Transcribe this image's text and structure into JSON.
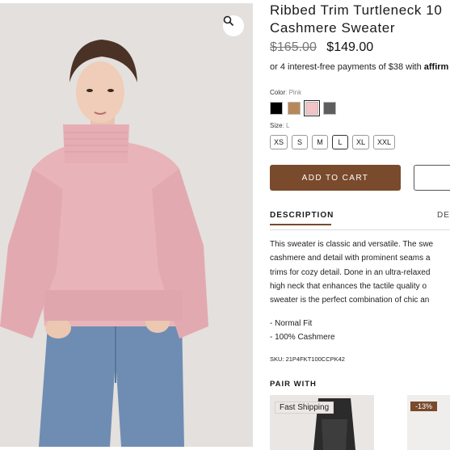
{
  "product": {
    "title_line1": "Ribbed Trim Turtleneck 10",
    "title_line2": "Cashmere Sweater",
    "old_price": "$165.00",
    "price": "$149.00",
    "installments_text": "or 4 interest-free payments of $38 with",
    "installments_provider": "affirm",
    "color_label": "Color",
    "color_value": ": Pink",
    "colors": [
      "#000000",
      "#b8885a",
      "#f2c4c6",
      "#5e5e5e"
    ],
    "selected_color_index": 2,
    "size_label": "Size",
    "size_value": ": L",
    "sizes": [
      "XS",
      "S",
      "M",
      "L",
      "XL",
      "XXL"
    ],
    "selected_size_index": 3,
    "add_to_cart": "ADD TO CART",
    "accent_color": "#7a4a2c"
  },
  "tabs": {
    "description": "DESCRIPTION",
    "details": "DE"
  },
  "description_lines": [
    "This sweater is classic and versatile. The swe",
    "cashmere and detail with prominent seams a",
    "trims for cozy detail. Done in an ultra-relaxed",
    "high neck that enhances the tactile quality o",
    "sweater is the perfect combination of chic an"
  ],
  "features": [
    "- Normal Fit",
    "- 100% Cashmere"
  ],
  "sku": "SKU: 21P4FKT100CCPK42",
  "pair_with": {
    "title": "PAIR WITH",
    "card1_badge": "Fast Shipping",
    "card2_badge": "-13%"
  },
  "icons": {
    "zoom": "magnifier-icon"
  }
}
